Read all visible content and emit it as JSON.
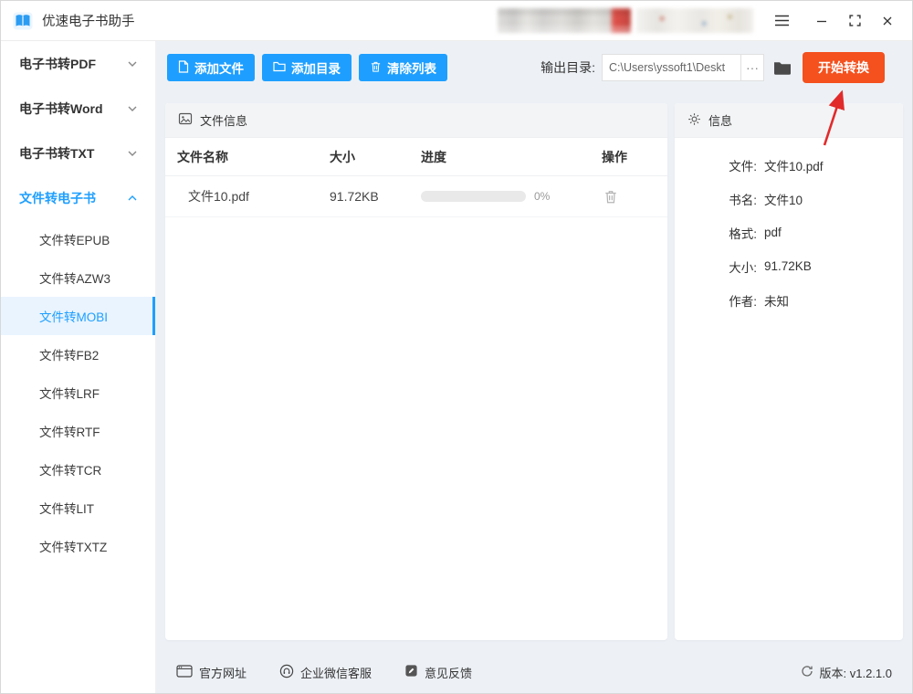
{
  "titlebar": {
    "app_title": "优速电子书助手"
  },
  "sidebar": {
    "groups": [
      "电子书转PDF",
      "电子书转Word",
      "电子书转TXT",
      "文件转电子书"
    ],
    "expanded_group": "文件转电子书",
    "sub_items": [
      "文件转EPUB",
      "文件转AZW3",
      "文件转MOBI",
      "文件转FB2",
      "文件转LRF",
      "文件转RTF",
      "文件转TCR",
      "文件转LIT",
      "文件转TXTZ"
    ],
    "selected_item": "文件转MOBI"
  },
  "toolbar": {
    "add_file": "添加文件",
    "add_folder": "添加目录",
    "clear_list": "清除列表",
    "output_label": "输出目录:",
    "output_path": "C:\\Users\\yssoft1\\Deskt",
    "more": "···",
    "convert": "开始转换"
  },
  "file_panel": {
    "title": "文件信息",
    "columns": [
      "文件名称",
      "大小",
      "进度",
      "操作"
    ],
    "rows": [
      {
        "name": "文件10.pdf",
        "size": "91.72KB",
        "progress_pct": 0,
        "progress_text": "0%"
      }
    ]
  },
  "info_panel": {
    "title": "信息",
    "fields": [
      {
        "label": "文件:",
        "value": "文件10.pdf"
      },
      {
        "label": "书名:",
        "value": "文件10"
      },
      {
        "label": "格式:",
        "value": "pdf"
      },
      {
        "label": "大小:",
        "value": "91.72KB"
      },
      {
        "label": "作者:",
        "value": "未知"
      }
    ]
  },
  "footer": {
    "links": [
      "官方网址",
      "企业微信客服",
      "意见反馈"
    ],
    "version": "版本: v1.2.1.0"
  },
  "colors": {
    "accent_blue": "#1e9fff",
    "convert_orange": "#f4511e",
    "selected_bg": "#e9f4ff",
    "main_bg": "#edf1f6",
    "arrow_red": "#e12b2b"
  },
  "icons": {
    "app_logo": "blue-book",
    "menu": "hamburger",
    "minimize": "minus",
    "maximize": "fullscreen-corners",
    "close": "x",
    "add_file": "document",
    "add_folder": "folder-outline",
    "clear_list": "trash",
    "output_browse": "folder-filled",
    "file_panel": "image",
    "info_panel": "gear",
    "row_delete": "trash",
    "website": "browser-window",
    "wechat_support": "chat-headset",
    "feedback": "note-pencil",
    "version": "refresh-arrow",
    "annotation": "red-arrow-up"
  }
}
